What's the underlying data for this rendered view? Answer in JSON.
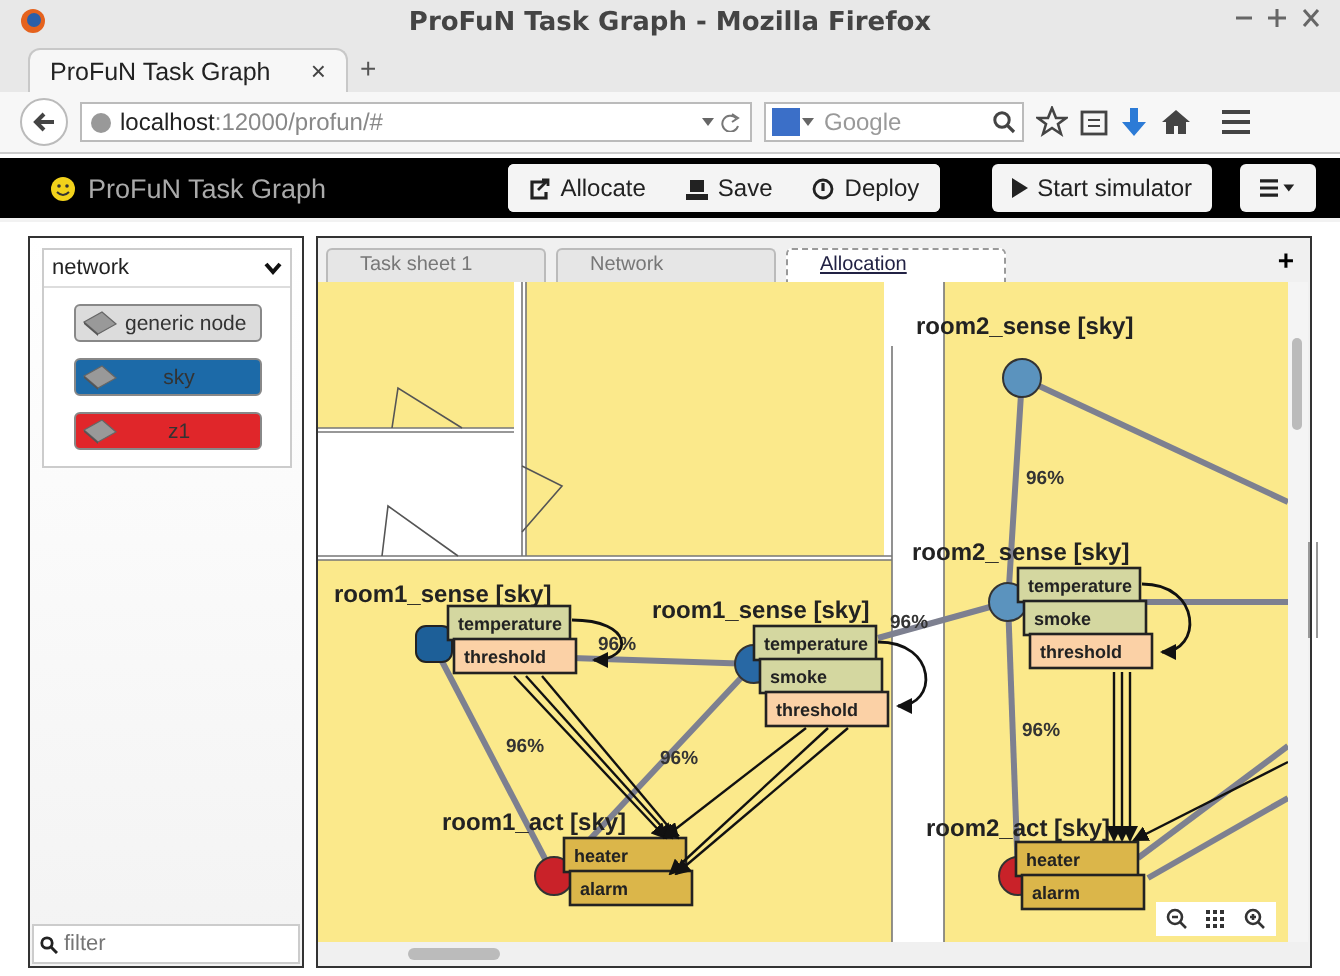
{
  "window": {
    "title": "ProFuN Task Graph - Mozilla Firefox"
  },
  "browser_tabs": [
    {
      "label": "ProFuN Task Graph",
      "close": "×",
      "selected": true
    }
  ],
  "new_tab": "+",
  "address_bar": {
    "host": "localhost",
    "path": ":12000/profun/#"
  },
  "search": {
    "placeholder": "Google"
  },
  "app": {
    "brand": "ProFuN Task Graph",
    "buttons": [
      {
        "label": "Allocate",
        "kind": "allocate"
      },
      {
        "label": "Save",
        "kind": "save"
      },
      {
        "label": "Deploy",
        "kind": "deploy"
      }
    ],
    "simulator_button": {
      "label": "Start simulator"
    }
  },
  "palette": {
    "select": "network",
    "items": [
      {
        "label": "generic node",
        "color": "#dcdcdc"
      },
      {
        "label": "sky",
        "color": "#1c6aa8"
      },
      {
        "label": "z1",
        "color": "#e0262a"
      }
    ],
    "filter": {
      "placeholder": "filter"
    }
  },
  "sheet_tabs": [
    {
      "label": "Task sheet 1",
      "selected": false
    },
    {
      "label": "Network",
      "selected": false
    },
    {
      "label": "Allocation",
      "selected": true
    }
  ],
  "add_sheet": "+",
  "graph": {
    "nodes": [
      {
        "label": "room1_sense [sky]",
        "color": "#1d5f98",
        "services": [
          {
            "name": "temperature",
            "kind": "sensor"
          },
          {
            "name": "threshold",
            "kind": "filter"
          }
        ]
      },
      {
        "label": "room1_sense [sky]",
        "color": "#2868a4",
        "services": [
          {
            "name": "temperature",
            "kind": "sensor"
          },
          {
            "name": "smoke",
            "kind": "sensor"
          },
          {
            "name": "threshold",
            "kind": "filter"
          }
        ]
      },
      {
        "label": "room1_act [sky]",
        "color": "#c92229",
        "services": [
          {
            "name": "heater",
            "kind": "actuator"
          },
          {
            "name": "alarm",
            "kind": "actuator"
          }
        ]
      },
      {
        "label": "room2_sense [sky]",
        "color": "#5b93be"
      },
      {
        "label": "room2_sense [sky]",
        "color": "#5b93be",
        "services": [
          {
            "name": "temperature",
            "kind": "sensor"
          },
          {
            "name": "smoke",
            "kind": "sensor"
          },
          {
            "name": "threshold",
            "kind": "filter"
          }
        ]
      },
      {
        "label": "room2_act [sky]",
        "color": "#c92229",
        "services": [
          {
            "name": "heater",
            "kind": "actuator"
          },
          {
            "name": "alarm",
            "kind": "actuator"
          }
        ]
      }
    ],
    "link_labels": [
      "96%",
      "96%",
      "96%",
      "96%",
      "96%",
      "96%"
    ]
  }
}
